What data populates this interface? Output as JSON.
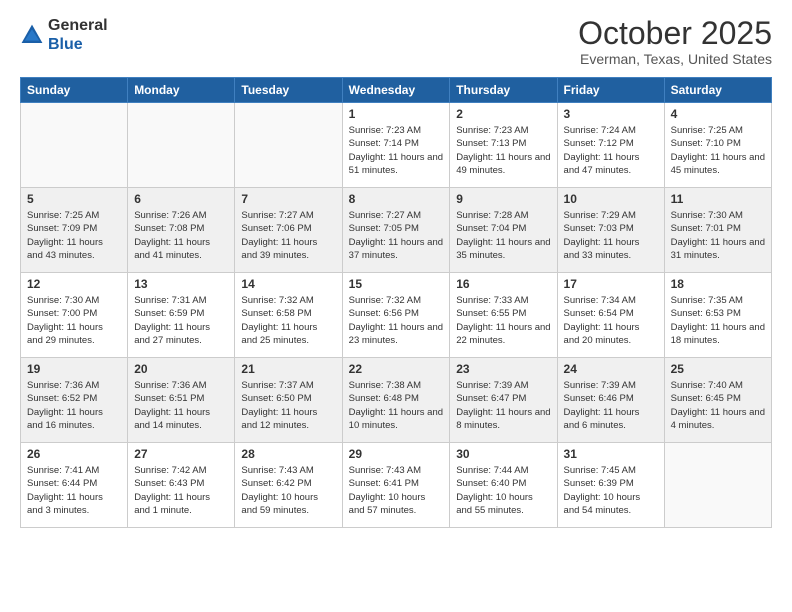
{
  "header": {
    "logo_general": "General",
    "logo_blue": "Blue",
    "month_title": "October 2025",
    "location": "Everman, Texas, United States"
  },
  "days_of_week": [
    "Sunday",
    "Monday",
    "Tuesday",
    "Wednesday",
    "Thursday",
    "Friday",
    "Saturday"
  ],
  "weeks": [
    [
      {
        "day": "",
        "info": ""
      },
      {
        "day": "",
        "info": ""
      },
      {
        "day": "",
        "info": ""
      },
      {
        "day": "1",
        "info": "Sunrise: 7:23 AM\nSunset: 7:14 PM\nDaylight: 11 hours and 51 minutes."
      },
      {
        "day": "2",
        "info": "Sunrise: 7:23 AM\nSunset: 7:13 PM\nDaylight: 11 hours and 49 minutes."
      },
      {
        "day": "3",
        "info": "Sunrise: 7:24 AM\nSunset: 7:12 PM\nDaylight: 11 hours and 47 minutes."
      },
      {
        "day": "4",
        "info": "Sunrise: 7:25 AM\nSunset: 7:10 PM\nDaylight: 11 hours and 45 minutes."
      }
    ],
    [
      {
        "day": "5",
        "info": "Sunrise: 7:25 AM\nSunset: 7:09 PM\nDaylight: 11 hours and 43 minutes."
      },
      {
        "day": "6",
        "info": "Sunrise: 7:26 AM\nSunset: 7:08 PM\nDaylight: 11 hours and 41 minutes."
      },
      {
        "day": "7",
        "info": "Sunrise: 7:27 AM\nSunset: 7:06 PM\nDaylight: 11 hours and 39 minutes."
      },
      {
        "day": "8",
        "info": "Sunrise: 7:27 AM\nSunset: 7:05 PM\nDaylight: 11 hours and 37 minutes."
      },
      {
        "day": "9",
        "info": "Sunrise: 7:28 AM\nSunset: 7:04 PM\nDaylight: 11 hours and 35 minutes."
      },
      {
        "day": "10",
        "info": "Sunrise: 7:29 AM\nSunset: 7:03 PM\nDaylight: 11 hours and 33 minutes."
      },
      {
        "day": "11",
        "info": "Sunrise: 7:30 AM\nSunset: 7:01 PM\nDaylight: 11 hours and 31 minutes."
      }
    ],
    [
      {
        "day": "12",
        "info": "Sunrise: 7:30 AM\nSunset: 7:00 PM\nDaylight: 11 hours and 29 minutes."
      },
      {
        "day": "13",
        "info": "Sunrise: 7:31 AM\nSunset: 6:59 PM\nDaylight: 11 hours and 27 minutes."
      },
      {
        "day": "14",
        "info": "Sunrise: 7:32 AM\nSunset: 6:58 PM\nDaylight: 11 hours and 25 minutes."
      },
      {
        "day": "15",
        "info": "Sunrise: 7:32 AM\nSunset: 6:56 PM\nDaylight: 11 hours and 23 minutes."
      },
      {
        "day": "16",
        "info": "Sunrise: 7:33 AM\nSunset: 6:55 PM\nDaylight: 11 hours and 22 minutes."
      },
      {
        "day": "17",
        "info": "Sunrise: 7:34 AM\nSunset: 6:54 PM\nDaylight: 11 hours and 20 minutes."
      },
      {
        "day": "18",
        "info": "Sunrise: 7:35 AM\nSunset: 6:53 PM\nDaylight: 11 hours and 18 minutes."
      }
    ],
    [
      {
        "day": "19",
        "info": "Sunrise: 7:36 AM\nSunset: 6:52 PM\nDaylight: 11 hours and 16 minutes."
      },
      {
        "day": "20",
        "info": "Sunrise: 7:36 AM\nSunset: 6:51 PM\nDaylight: 11 hours and 14 minutes."
      },
      {
        "day": "21",
        "info": "Sunrise: 7:37 AM\nSunset: 6:50 PM\nDaylight: 11 hours and 12 minutes."
      },
      {
        "day": "22",
        "info": "Sunrise: 7:38 AM\nSunset: 6:48 PM\nDaylight: 11 hours and 10 minutes."
      },
      {
        "day": "23",
        "info": "Sunrise: 7:39 AM\nSunset: 6:47 PM\nDaylight: 11 hours and 8 minutes."
      },
      {
        "day": "24",
        "info": "Sunrise: 7:39 AM\nSunset: 6:46 PM\nDaylight: 11 hours and 6 minutes."
      },
      {
        "day": "25",
        "info": "Sunrise: 7:40 AM\nSunset: 6:45 PM\nDaylight: 11 hours and 4 minutes."
      }
    ],
    [
      {
        "day": "26",
        "info": "Sunrise: 7:41 AM\nSunset: 6:44 PM\nDaylight: 11 hours and 3 minutes."
      },
      {
        "day": "27",
        "info": "Sunrise: 7:42 AM\nSunset: 6:43 PM\nDaylight: 11 hours and 1 minute."
      },
      {
        "day": "28",
        "info": "Sunrise: 7:43 AM\nSunset: 6:42 PM\nDaylight: 10 hours and 59 minutes."
      },
      {
        "day": "29",
        "info": "Sunrise: 7:43 AM\nSunset: 6:41 PM\nDaylight: 10 hours and 57 minutes."
      },
      {
        "day": "30",
        "info": "Sunrise: 7:44 AM\nSunset: 6:40 PM\nDaylight: 10 hours and 55 minutes."
      },
      {
        "day": "31",
        "info": "Sunrise: 7:45 AM\nSunset: 6:39 PM\nDaylight: 10 hours and 54 minutes."
      },
      {
        "day": "",
        "info": ""
      }
    ]
  ]
}
